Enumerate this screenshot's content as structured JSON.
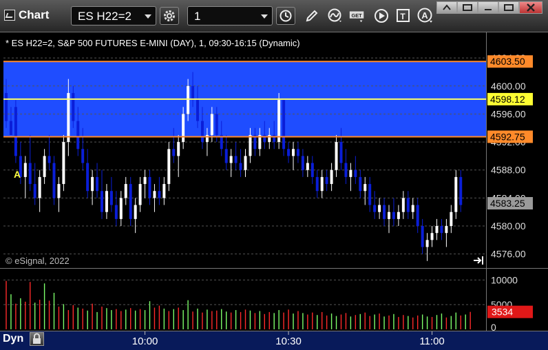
{
  "window": {
    "title": "Chart"
  },
  "toolbar": {
    "symbol": "ES H22=2",
    "interval": "1",
    "icons": [
      "settings-gear-icon",
      "clock-icon",
      "pencil-icon",
      "study-curve-icon",
      "get-data-icon",
      "play-icon",
      "text-tool-icon",
      "alert-icon"
    ]
  },
  "info_line": "* ES H22=2, S&P 500 FUTURES E-MINI (DAY), 1, 09:30-16:15 (Dynamic)",
  "copyright": "© eSignal, 2022",
  "marker_label": "A",
  "footer": {
    "mode": "Dyn"
  },
  "colors": {
    "band": "#1f4dff",
    "down": "#0a1ed8",
    "up": "#ffffff",
    "orange_line": "#ff8a2a",
    "yellow_line": "#ffff66",
    "vol_up": "#7dff6a",
    "vol_down": "#ff2a2a"
  },
  "chart_data": {
    "type": "candlestick",
    "ylim": [
      4574,
      4605
    ],
    "yticks": [
      4576.0,
      4580.0,
      4584.0,
      4588.0,
      4592.0,
      4596.0,
      4600.0,
      4604.0
    ],
    "ytick_labels": [
      "4576.00",
      "4580.00",
      "4584.00",
      "4588.00",
      "4592.00",
      "4596.00",
      "4600.00",
      "4604.00"
    ],
    "x_labels": [
      {
        "label": "10:00",
        "index": 29
      },
      {
        "label": "10:30",
        "index": 59
      },
      {
        "label": "11:00",
        "index": 89
      }
    ],
    "band": [
      4592.75,
      4603.5
    ],
    "lines": [
      {
        "value": 4603.5,
        "label": "4603.50",
        "color": "orange"
      },
      {
        "value": 4598.12,
        "label": "4598.12",
        "color": "yellow"
      },
      {
        "value": 4592.75,
        "label": "4592.75",
        "color": "orange"
      },
      {
        "value": 4583.25,
        "label": "4583.25",
        "color": "gray"
      }
    ],
    "last_price": 4583.25,
    "volume": {
      "ylim": [
        0,
        12000
      ],
      "yticks": [
        0,
        5000,
        10000
      ],
      "ytick_labels": [
        "0",
        "5000",
        "10000"
      ],
      "last_label": "3534",
      "values": [
        9800,
        7100,
        5200,
        6300,
        5600,
        9600,
        5400,
        6000,
        9300,
        5800,
        7400,
        4600,
        5100,
        3900,
        4900,
        4400,
        4200,
        3800,
        5200,
        3500,
        4600,
        4300,
        3900,
        4100,
        3700,
        4000,
        4300,
        3800,
        4100,
        3900,
        5700,
        4400,
        4800,
        4200,
        3700,
        4100,
        4400,
        3900,
        5900,
        3600,
        4200,
        3400,
        4000,
        3700,
        3800,
        4100,
        3600,
        3400,
        3900,
        3500,
        4000,
        3800,
        3300,
        3700,
        3100,
        3500,
        3300,
        3900,
        3400,
        4000,
        3200,
        3700,
        3300,
        3000,
        3400,
        2900,
        3500,
        2800,
        3200,
        2700,
        3000,
        3300,
        2600,
        2900,
        3100,
        3400,
        2700,
        3000,
        3200,
        2600,
        2800,
        3100,
        2500,
        2900,
        2700,
        2400,
        2800,
        3000,
        2600,
        2500,
        2900,
        3200,
        2400,
        2700,
        3400,
        2800,
        3000,
        3534
      ],
      "up": [
        false,
        true,
        false,
        true,
        false,
        false,
        true,
        false,
        true,
        false,
        true,
        false,
        true,
        false,
        false,
        true,
        false,
        true,
        false,
        true,
        false,
        true,
        true,
        false,
        false,
        true,
        false,
        true,
        false,
        true,
        true,
        false,
        false,
        true,
        false,
        true,
        false,
        true,
        true,
        false,
        true,
        false,
        true,
        false,
        false,
        true,
        true,
        false,
        true,
        false,
        false,
        true,
        false,
        true,
        false,
        false,
        true,
        true,
        false,
        false,
        true,
        false,
        true,
        false,
        false,
        true,
        false,
        false,
        true,
        true,
        false,
        false,
        true,
        false,
        true,
        false,
        false,
        true,
        false,
        true,
        false,
        true,
        false,
        false,
        true,
        false,
        false,
        true,
        true,
        false,
        true,
        true,
        false,
        true,
        true,
        false,
        true,
        false
      ]
    },
    "ohlc": [
      [
        4599,
        4601,
        4594,
        4595
      ],
      [
        4595,
        4597,
        4593,
        4593
      ],
      [
        4597,
        4598,
        4589,
        4590
      ],
      [
        4590,
        4592,
        4586,
        4587
      ],
      [
        4587,
        4590,
        4584,
        4589
      ],
      [
        4589,
        4593,
        4585,
        4586
      ],
      [
        4586,
        4589,
        4583,
        4584
      ],
      [
        4584,
        4588,
        4582,
        4587
      ],
      [
        4587,
        4591,
        4586,
        4590
      ],
      [
        4590,
        4593,
        4588,
        4589
      ],
      [
        4589,
        4590,
        4583,
        4584
      ],
      [
        4584,
        4587,
        4582,
        4586
      ],
      [
        4586,
        4593,
        4585,
        4592
      ],
      [
        4592,
        4601,
        4590,
        4599
      ],
      [
        4599,
        4600,
        4594,
        4595
      ],
      [
        4595,
        4597,
        4590,
        4591
      ],
      [
        4591,
        4594,
        4588,
        4589
      ],
      [
        4589,
        4591,
        4584,
        4585
      ],
      [
        4585,
        4588,
        4583,
        4587
      ],
      [
        4587,
        4589,
        4584,
        4585
      ],
      [
        4585,
        4588,
        4581,
        4582
      ],
      [
        4582,
        4586,
        4581,
        4585
      ],
      [
        4585,
        4587,
        4582,
        4583
      ],
      [
        4583,
        4585,
        4580,
        4581
      ],
      [
        4581,
        4585,
        4580,
        4584
      ],
      [
        4584,
        4587,
        4583,
        4586
      ],
      [
        4586,
        4587,
        4580,
        4581
      ],
      [
        4581,
        4584,
        4579,
        4583
      ],
      [
        4583,
        4587,
        4582,
        4586
      ],
      [
        4586,
        4588,
        4584,
        4587
      ],
      [
        4587,
        4588,
        4583,
        4584
      ],
      [
        4584,
        4586,
        4582,
        4585
      ],
      [
        4585,
        4587,
        4583,
        4584
      ],
      [
        4584,
        4587,
        4583,
        4586
      ],
      [
        4586,
        4592,
        4585,
        4591
      ],
      [
        4591,
        4594,
        4589,
        4590
      ],
      [
        4590,
        4593,
        4587,
        4592
      ],
      [
        4592,
        4597,
        4591,
        4596
      ],
      [
        4596,
        4601,
        4595,
        4600
      ],
      [
        4600,
        4602,
        4597,
        4598
      ],
      [
        4598,
        4600,
        4594,
        4595
      ],
      [
        4595,
        4597,
        4591,
        4592
      ],
      [
        4592,
        4594,
        4590,
        4593
      ],
      [
        4593,
        4597,
        4592,
        4596
      ],
      [
        4596,
        4597,
        4592,
        4593
      ],
      [
        4593,
        4595,
        4590,
        4591
      ],
      [
        4591,
        4593,
        4588,
        4589
      ],
      [
        4589,
        4591,
        4587,
        4590
      ],
      [
        4590,
        4592,
        4588,
        4589
      ],
      [
        4589,
        4591,
        4587,
        4588
      ],
      [
        4588,
        4591,
        4587,
        4590
      ],
      [
        4590,
        4594,
        4589,
        4593
      ],
      [
        4593,
        4594,
        4590,
        4591
      ],
      [
        4591,
        4594,
        4590,
        4593
      ],
      [
        4593,
        4595,
        4591,
        4592
      ],
      [
        4592,
        4594,
        4591,
        4593
      ],
      [
        4593,
        4595,
        4591,
        4592
      ],
      [
        4592,
        4599,
        4591,
        4598
      ],
      [
        4598,
        4598,
        4590,
        4591
      ],
      [
        4591,
        4592,
        4589,
        4590
      ],
      [
        4590,
        4592,
        4588,
        4591
      ],
      [
        4591,
        4592,
        4589,
        4590
      ],
      [
        4590,
        4591,
        4587,
        4588
      ],
      [
        4588,
        4590,
        4587,
        4589
      ],
      [
        4589,
        4590,
        4586,
        4587
      ],
      [
        4587,
        4588,
        4584,
        4585
      ],
      [
        4585,
        4588,
        4584,
        4587
      ],
      [
        4587,
        4588,
        4585,
        4586
      ],
      [
        4586,
        4589,
        4585,
        4588
      ],
      [
        4588,
        4593,
        4587,
        4592
      ],
      [
        4592,
        4594,
        4588,
        4589
      ],
      [
        4589,
        4591,
        4586,
        4587
      ],
      [
        4587,
        4589,
        4585,
        4588
      ],
      [
        4588,
        4590,
        4586,
        4587
      ],
      [
        4587,
        4588,
        4584,
        4585
      ],
      [
        4585,
        4587,
        4583,
        4586
      ],
      [
        4586,
        4587,
        4582,
        4583
      ],
      [
        4583,
        4585,
        4581,
        4582
      ],
      [
        4582,
        4584,
        4581,
        4583
      ],
      [
        4583,
        4584,
        4580,
        4581
      ],
      [
        4581,
        4583,
        4579,
        4582
      ],
      [
        4582,
        4584,
        4580,
        4581
      ],
      [
        4581,
        4583,
        4580,
        4582
      ],
      [
        4582,
        4585,
        4581,
        4584
      ],
      [
        4584,
        4585,
        4581,
        4582
      ],
      [
        4582,
        4584,
        4581,
        4583
      ],
      [
        4583,
        4584,
        4579,
        4580
      ],
      [
        4580,
        4581,
        4576,
        4577
      ],
      [
        4577,
        4579,
        4575,
        4578
      ],
      [
        4578,
        4580,
        4577,
        4579
      ],
      [
        4579,
        4581,
        4578,
        4580
      ],
      [
        4580,
        4581,
        4578,
        4579
      ],
      [
        4579,
        4581,
        4577,
        4580
      ],
      [
        4580,
        4583,
        4579,
        4582
      ],
      [
        4582,
        4588,
        4581,
        4587
      ],
      [
        4587,
        4588,
        4582,
        4583
      ]
    ]
  }
}
